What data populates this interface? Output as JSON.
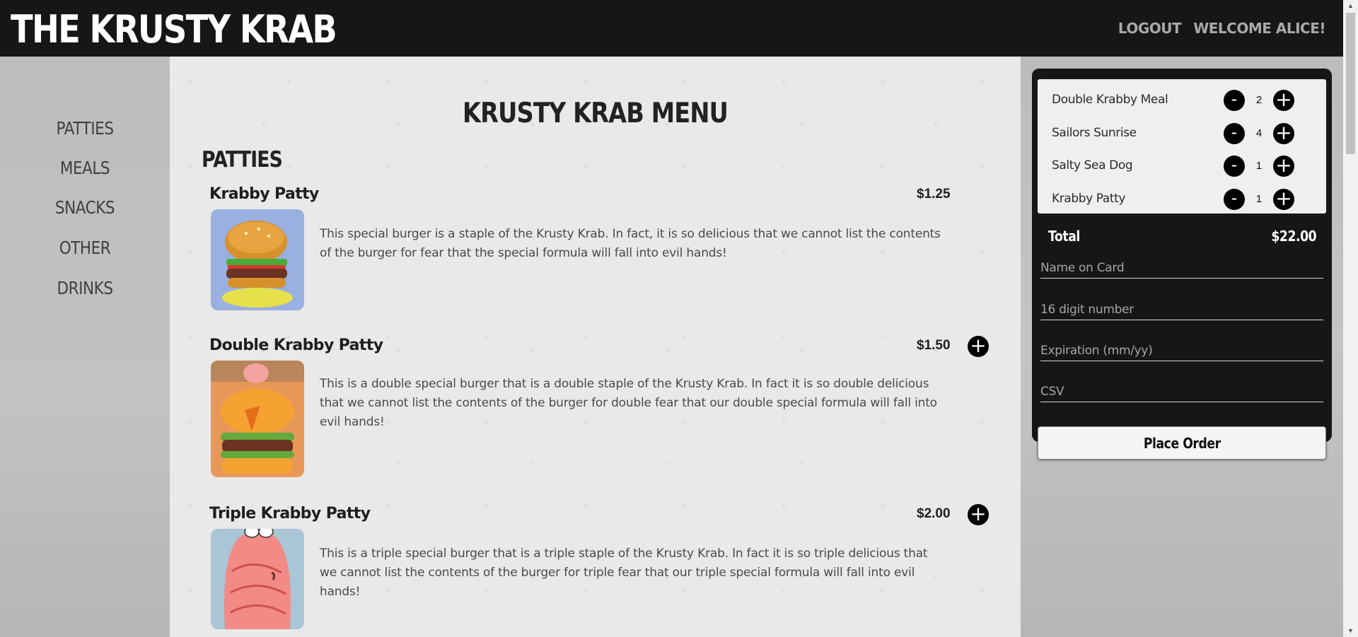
{
  "header": {
    "brand": "THE KRUSTY KRAB",
    "logout_label": "LOGOUT",
    "welcome_label": "WELCOME ALICE!"
  },
  "sidebar": {
    "items": [
      {
        "label": "PATTIES"
      },
      {
        "label": "MEALS"
      },
      {
        "label": "SNACKS"
      },
      {
        "label": "OTHER"
      },
      {
        "label": "DRINKS"
      }
    ]
  },
  "main": {
    "title": "KRUSTY KRAB MENU",
    "section": "PATTIES",
    "items": [
      {
        "name": "Krabby Patty",
        "price": "$1.25",
        "description": "This special burger is a staple of the Krusty Krab. In fact, it is so delicious that we cannot list the contents of the burger for fear that the special formula will fall into evil hands!",
        "add_icon": "plus-icon"
      },
      {
        "name": "Double Krabby Patty",
        "price": "$1.50",
        "description": "This is a double special burger that is a double staple of the Krusty Krab. In fact it is so double delicious that we cannot list the contents of the burger for double fear that our double special formula will fall into evil hands!",
        "add_icon": "plus-icon"
      },
      {
        "name": "Triple Krabby Patty",
        "price": "$2.00",
        "description": "This is a triple special burger that is a triple staple of the Krusty Krab. In fact it is so triple delicious that we cannot list the contents of the burger for triple fear that our triple special formula will fall into evil hands!",
        "add_icon": "plus-icon"
      }
    ]
  },
  "cart": {
    "items": [
      {
        "name": "Double Krabby Meal",
        "qty": "2"
      },
      {
        "name": "Sailors Sunrise",
        "qty": "4"
      },
      {
        "name": "Salty Sea Dog",
        "qty": "1"
      },
      {
        "name": "Krabby Patty",
        "qty": "1"
      }
    ],
    "minus_label": "-",
    "plus_label": "+",
    "total_label": "Total",
    "total_value": "$22.00",
    "fields": {
      "name_placeholder": "Name on Card",
      "number_placeholder": "16 digit number",
      "expiration_placeholder": "Expiration (mm/yy)",
      "csv_placeholder": "CSV"
    },
    "place_order_label": "Place Order"
  },
  "colors": {
    "topbar": "#161616",
    "cart_background": "#161616",
    "accent": "#000000"
  }
}
